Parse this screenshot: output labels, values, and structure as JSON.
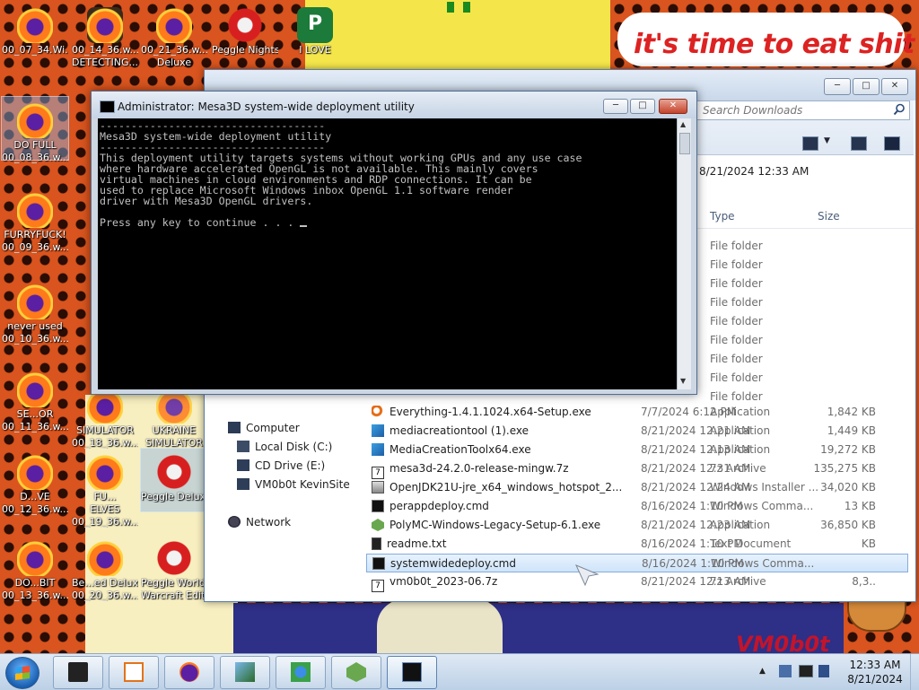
{
  "wallpaper": {
    "speech_text": "it's time to eat shit",
    "stamp_text": "VM0b0t"
  },
  "desktop_icons": [
    {
      "label": "00_07_34.Wi...",
      "type": "firefox"
    },
    {
      "label": "00_14_36.w...",
      "label2": "DETECTING...",
      "type": "firefox"
    },
    {
      "label": "00_21_36.w...",
      "label2": "Deluxe",
      "type": "firefox"
    },
    {
      "label": "Peggle Nights",
      "type": "peggle"
    },
    {
      "label": "I LOVE",
      "type": "publisher"
    },
    {
      "label": "00_08_36.w...",
      "label2": "DO FULL",
      "type": "firefox"
    },
    {
      "label": "FURRYFUCK!",
      "label2": "00_09_36.w...",
      "type": "firefox"
    },
    {
      "label": "never used",
      "label2": "00_10_36.w...",
      "type": "firefox"
    },
    {
      "label": "SE...OR",
      "label2": "00_11_36.w...",
      "type": "firefox"
    },
    {
      "label": "E...",
      "label2": "SIMULATOR",
      "label3": "00_18_36.w...",
      "type": "firefox"
    },
    {
      "label": "UKRAINE",
      "label2": "SIMULATOR",
      "type": "firefox"
    },
    {
      "label": "D...VE",
      "label2": "00_12_36.w...",
      "type": "firefox"
    },
    {
      "label": "FU...",
      "label2": "ELVES",
      "label3": "00_19_36.w...",
      "type": "firefox"
    },
    {
      "label": "Peggle Deluxe",
      "type": "peggle"
    },
    {
      "label": "DO...BIT",
      "label2": "00_13_36.w...",
      "type": "firefox"
    },
    {
      "label": "Be...ed Deluxe",
      "label2": "00_20_36.w...",
      "type": "firefox"
    },
    {
      "label": "Peggle World of",
      "label2": "Warcraft Edition",
      "type": "peggle"
    }
  ],
  "explorer": {
    "search_placeholder": "Search Downloads",
    "top_date": "8/21/2024 12:33 AM",
    "columns": {
      "type": "Type",
      "size": "Size"
    },
    "nav": {
      "computer": "Computer",
      "local_disk": "Local Disk (C:)",
      "cd_drive": "CD Drive (E:)",
      "share": "VM0b0t KevinSite",
      "network": "Network"
    },
    "folder_rows_type": "File folder",
    "files": [
      {
        "name": "Everything-1.4.1.1024.x64-Setup.exe",
        "date": "7/7/2024 6:12 PM",
        "type": "Application",
        "size": "1,842 KB",
        "icon": "search"
      },
      {
        "name": "mediacreationtool (1).exe",
        "date": "8/21/2024 12:21 AM",
        "type": "Application",
        "size": "1,449 KB",
        "icon": "app"
      },
      {
        "name": "MediaCreationToolx64.exe",
        "date": "8/21/2024 12:13 AM",
        "type": "Application",
        "size": "19,272 KB",
        "icon": "app"
      },
      {
        "name": "mesa3d-24.2.0-release-mingw.7z",
        "date": "8/21/2024 12:31 AM",
        "type": "7z Archive",
        "size": "135,275 KB",
        "icon": "7z"
      },
      {
        "name": "OpenJDK21U-jre_x64_windows_hotspot_2...",
        "date": "8/21/2024 12:24 AM",
        "type": "Windows Installer ...",
        "size": "34,020 KB",
        "icon": "msi"
      },
      {
        "name": "perappdeploy.cmd",
        "date": "8/16/2024 1:10 PM",
        "type": "Windows Comma...",
        "size": "13 KB",
        "icon": "cmd"
      },
      {
        "name": "PolyMC-Windows-Legacy-Setup-6.1.exe",
        "date": "8/21/2024 12:23 AM",
        "type": "Application",
        "size": "36,850 KB",
        "icon": "poly"
      },
      {
        "name": "readme.txt",
        "date": "8/16/2024 1:10 PM",
        "type": "Text Document",
        "size": "KB",
        "icon": "txt"
      },
      {
        "name": "systemwidedeploy.cmd",
        "date": "8/16/2024 1:10 PM",
        "type": "Windows Comma...",
        "size": "",
        "icon": "cmd",
        "selected": true
      },
      {
        "name": "vm0b0t_2023-06.7z",
        "date": "8/21/2024 12:13 AM",
        "type": "7z Archive",
        "size": "8,3..",
        "icon": "7z"
      }
    ]
  },
  "console": {
    "title": "Administrator:  Mesa3D system-wide deployment utility",
    "rule": "------------------------------------",
    "heading": "Mesa3D system-wide deployment utility",
    "body_lines": [
      "This deployment utility targets systems without working GPUs and any use case",
      "where hardware accelerated OpenGL is not available. This mainly covers",
      "virtual machines in cloud environments and RDP connections. It can be",
      "used to replace Microsoft Windows inbox OpenGL 1.1 software render",
      "driver with Mesa3D OpenGL drivers."
    ],
    "prompt": "Press any key to continue . . . "
  },
  "taskbar": {
    "time": "12:33 AM",
    "date": "8/21/2024",
    "apps": [
      "terminal",
      "media-player",
      "firefox",
      "winrar-sfx",
      "download-manager",
      "polymc",
      "console"
    ]
  },
  "colors": {
    "accent": "#3a7bd5",
    "console_text": "#c0c0c0",
    "taskbar": "#c9daec"
  }
}
